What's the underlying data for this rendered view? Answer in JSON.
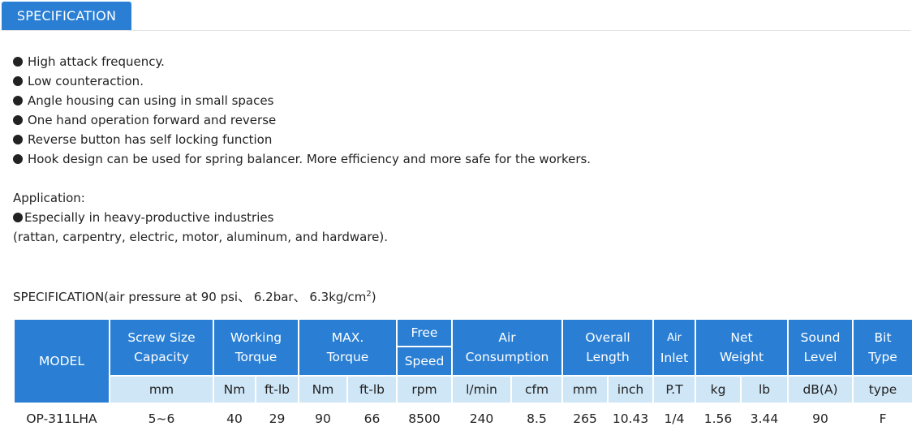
{
  "tab": {
    "label": "SPECIFICATION"
  },
  "features": [
    "High attack frequency.",
    "Low counteraction.",
    "Angle housing can using in small spaces",
    "One hand operation forward and reverse",
    "Reverse button has self locking function",
    "Hook design can be used for spring balancer. More efficiency and more safe for the workers."
  ],
  "application": {
    "heading": "Application:",
    "item": "Especially in heavy-productive industries",
    "note": "(rattan, carpentry, electric, motor, aluminum, and hardware)."
  },
  "spec_title": {
    "main": "SPECIFICATION(air pressure at 90 psi、 6.2bar、 6.3kg/cm",
    "sup": "2",
    "end": ")"
  },
  "table": {
    "headers": {
      "model": "MODEL",
      "screw_size_1": "Screw Size",
      "screw_size_2": "Capacity",
      "working_1": "Working",
      "working_2": "Torque",
      "max_1": "MAX.",
      "max_2": "Torque",
      "free_1": "Free",
      "free_2": "Speed",
      "air_1": "Air",
      "air_2": "Consumption",
      "overall_1": "Overall",
      "overall_2": "Length",
      "inlet_1": "Air",
      "inlet_2": "Inlet",
      "net_1": "Net",
      "net_2": "Weight",
      "sound_1": "Sound",
      "sound_2": "Level",
      "bit_1": "Bit",
      "bit_2": "Type"
    },
    "units": [
      "mm",
      "Nm",
      "ft-lb",
      "Nm",
      "ft-lb",
      "rpm",
      "l/min",
      "cfm",
      "mm",
      "inch",
      "P.T",
      "kg",
      "lb",
      "dB(A)",
      "type"
    ],
    "rows": [
      [
        "OP-311LHA",
        "5~6",
        "40",
        "29",
        "90",
        "66",
        "8500",
        "240",
        "8.5",
        "265",
        "10.43",
        "1/4",
        "1.56",
        "3.44",
        "90",
        "F"
      ]
    ],
    "colors": {
      "header_bg": "#2a7fd4",
      "unit_bg": "#cfe6f7",
      "bit_type": "#e02020"
    }
  }
}
